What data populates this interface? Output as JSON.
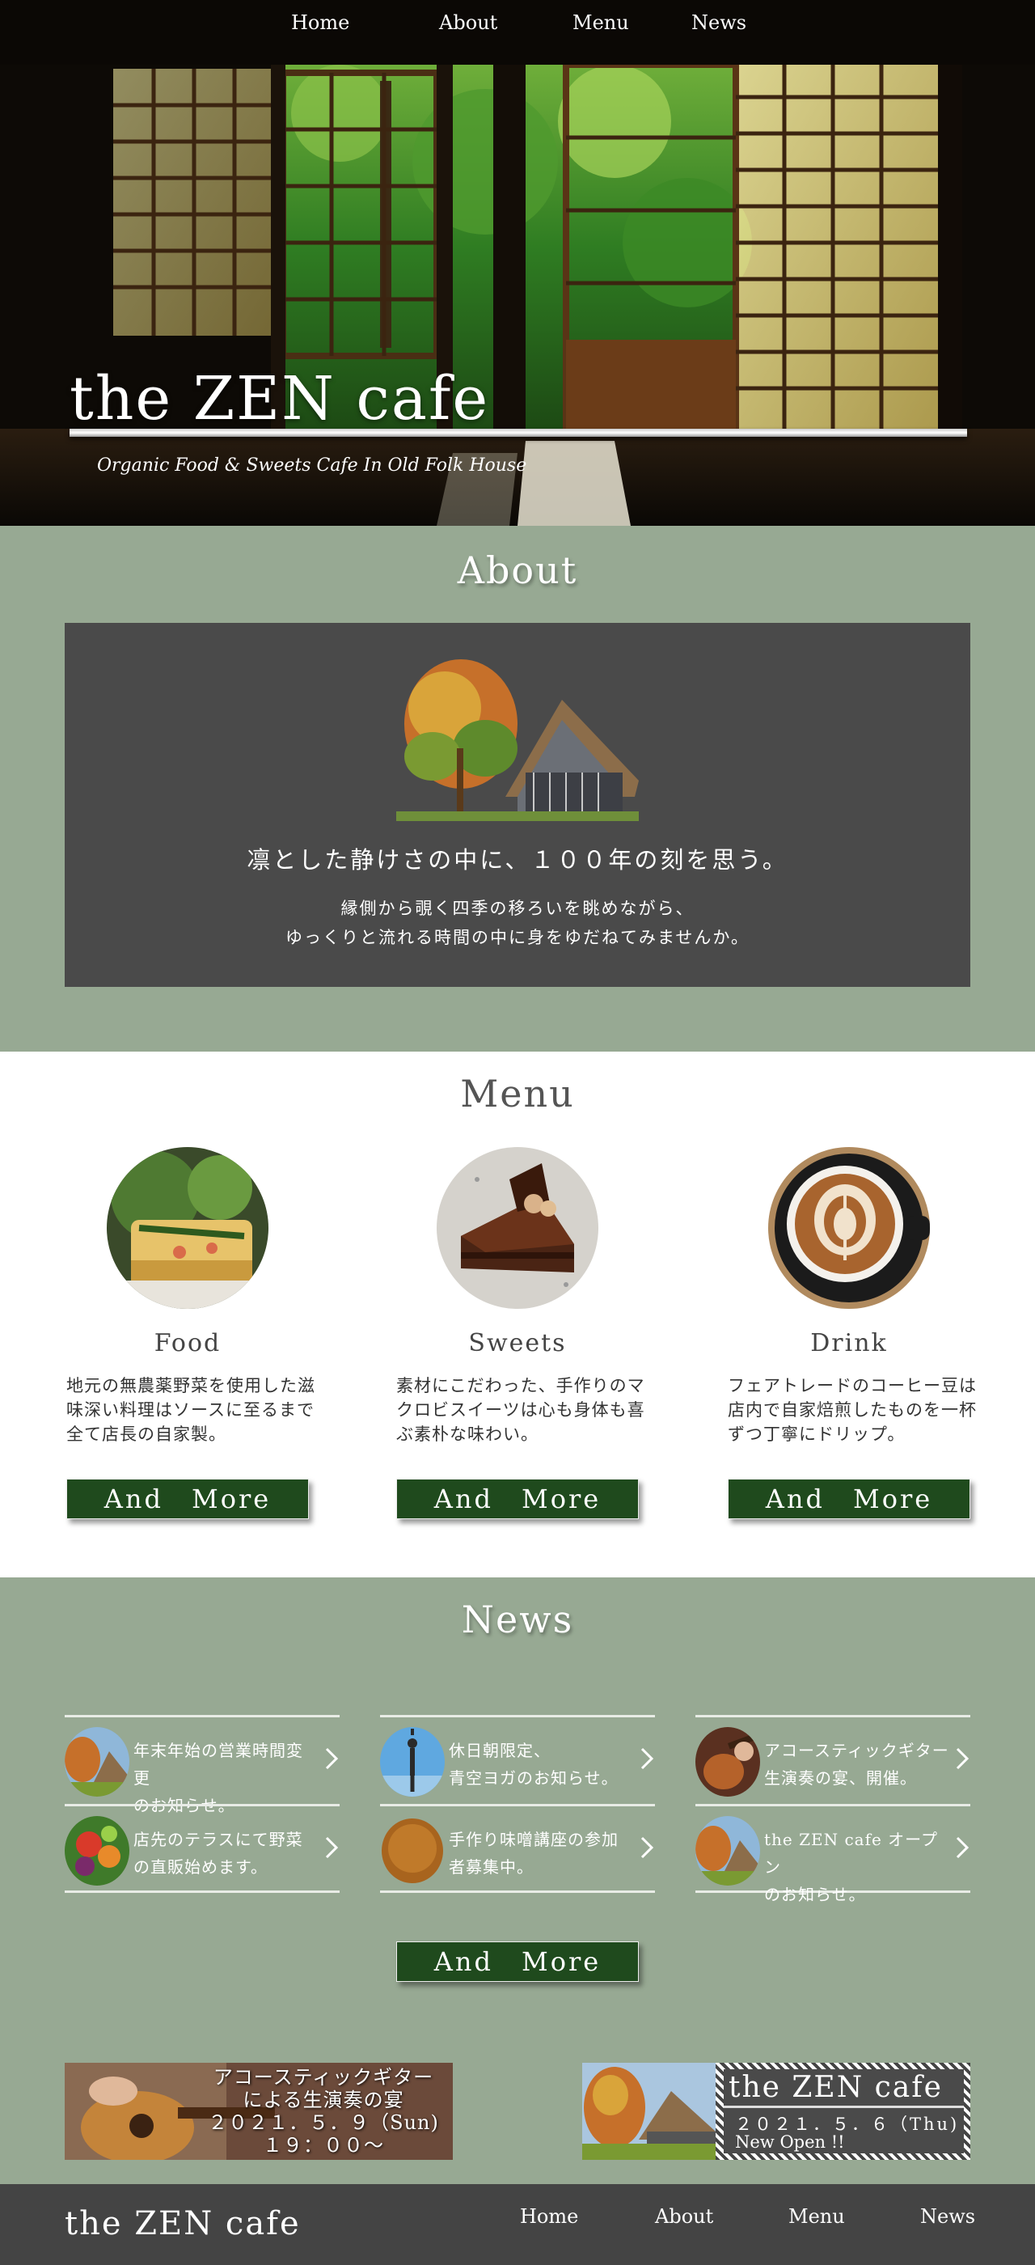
{
  "nav": {
    "items": [
      "Home",
      "About",
      "Menu",
      "News"
    ]
  },
  "hero": {
    "title": "the ZEN cafe",
    "subtitle": "Organic Food & Sweets Cafe In Old Folk House"
  },
  "about": {
    "title": "About",
    "heading": "凛とした静けさの中に、１００年の刻を思う。",
    "text_line1": "縁側から覗く四季の移ろいを眺めながら、",
    "text_line2": "ゆっくりと流れる時間の中に身をゆだねてみませんか。"
  },
  "menu": {
    "title": "Menu",
    "items": [
      {
        "name": "Food",
        "desc": "地元の無農薬野菜を使用した滋味深い料理はソースに至るまで全て店長の自家製。"
      },
      {
        "name": "Sweets",
        "desc": "素材にこだわった、手作りのマクロビスイーツは心も身体も喜ぶ素朴な味わい。"
      },
      {
        "name": "Drink",
        "desc": "フェアトレードのコーヒー豆は店内で自家焙煎したものを一杯ずつ丁寧にドリップ。"
      }
    ],
    "more_label": "And　More"
  },
  "news": {
    "title": "News",
    "items": [
      {
        "line1": "年末年始の営業時間変更",
        "line2": "のお知らせ。"
      },
      {
        "line1": "休日朝限定、",
        "line2": "青空ヨガのお知らせ。"
      },
      {
        "line1": "アコースティックギター",
        "line2": "生演奏の宴、開催。"
      },
      {
        "line1": "店先のテラスにて野菜",
        "line2": "の直販始めます。"
      },
      {
        "line1": "手作り味噌講座の参加",
        "line2": "者募集中。"
      },
      {
        "line1": "the ZEN cafe オープン",
        "line2": "のお知らせ。"
      }
    ],
    "more_label": "And　More",
    "banner1": {
      "line1": "アコースティックギター",
      "line2": "による生演奏の宴",
      "line3": "２０２１．５．９（Sun)",
      "line4": "１９：００〜"
    },
    "banner2": {
      "title": "the ZEN cafe",
      "line1": "２０２１．５．６（Thu)",
      "line2": "New Open !!"
    }
  },
  "footer": {
    "logo": "the ZEN cafe",
    "items": [
      "Home",
      "About",
      "Menu",
      "News"
    ]
  },
  "colors": {
    "sage": "#97a993",
    "dark_green": "#1f4a1d",
    "charcoal": "#4a4a4a",
    "footer": "#444444"
  }
}
